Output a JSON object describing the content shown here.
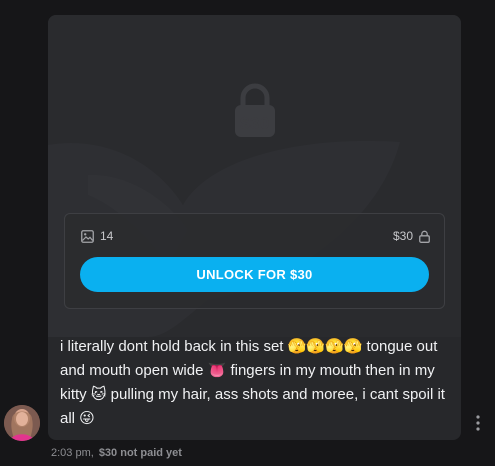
{
  "post": {
    "media_count": "14",
    "price": "$30",
    "lock_overlay_price": "$30",
    "unlock_button_label": "UNLOCK FOR $30",
    "caption": "i literally dont hold back in this set 🫣🫣🫣🫣 tongue out and mouth open wide 👅 fingers in my mouth then in my kitty 🐱 pulling my hair, ass shots and moree, i cant spoil it all 😜"
  },
  "footer": {
    "time": "2:03 pm,",
    "payment_status": "$30 not paid yet"
  },
  "icons": {
    "media": "image-icon",
    "price_lock": "lock-icon",
    "overlay_lock": "lock-icon",
    "more": "more-vertical-icon"
  },
  "colors": {
    "accent": "#0ab0f0",
    "card_background": "#27282b",
    "page_background": "#161618"
  }
}
